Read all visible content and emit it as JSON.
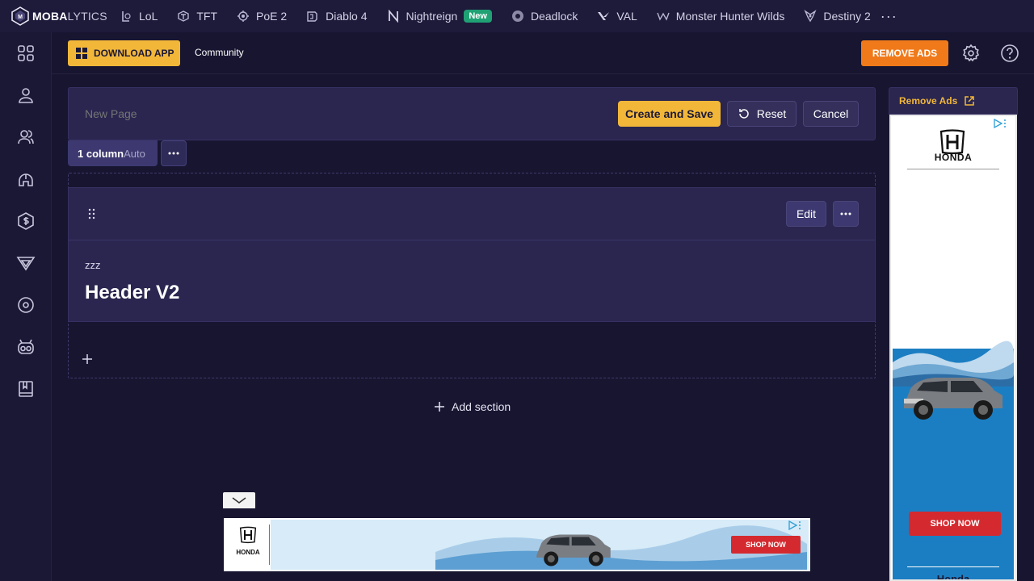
{
  "brand": {
    "name_bold": "MOBA",
    "name_light": "LYTICS"
  },
  "nav": {
    "games": [
      {
        "label": "LoL",
        "icon": "lol-icon"
      },
      {
        "label": "TFT",
        "icon": "tft-icon"
      },
      {
        "label": "PoE 2",
        "icon": "poe2-icon"
      },
      {
        "label": "Diablo 4",
        "icon": "diablo4-icon"
      },
      {
        "label": "Nightreign",
        "icon": "nightreign-icon",
        "badge": "New"
      },
      {
        "label": "Deadlock",
        "icon": "deadlock-icon"
      },
      {
        "label": "VAL",
        "icon": "valorant-icon"
      },
      {
        "label": "Monster Hunter Wilds",
        "icon": "mhwilds-icon"
      },
      {
        "label": "Destiny 2",
        "icon": "destiny2-icon"
      }
    ],
    "more": "···"
  },
  "sidebar": {
    "items": [
      "grid-icon",
      "profile-icon",
      "users-icon",
      "helmet-icon",
      "coin-icon",
      "valorant-side-icon",
      "disc-icon",
      "mascot-icon",
      "book-icon"
    ]
  },
  "subbar": {
    "download_label": "DOWNLOAD APP",
    "community_label": "Community",
    "remove_ads_label": "REMOVE ADS"
  },
  "editor": {
    "page_name_placeholder": "New Page",
    "create_label": "Create and Save",
    "reset_label": "Reset",
    "cancel_label": "Cancel",
    "columns_label": "1 column",
    "columns_mode": "Auto",
    "widget": {
      "edit_label": "Edit",
      "subtitle": "zzz",
      "title": "Header V2"
    },
    "add_section_label": "Add section"
  },
  "ads": {
    "remove_ads_link": "Remove Ads",
    "brand": "HONDA",
    "shop_label": "SHOP NOW",
    "footer_text": "Honda",
    "banner_shop_label": "SHOP NOW"
  },
  "colors": {
    "accent_yellow": "#f2b739",
    "accent_orange": "#f07a1a",
    "new_badge": "#1fa174",
    "background": "#171530",
    "panel": "#2a2650"
  }
}
